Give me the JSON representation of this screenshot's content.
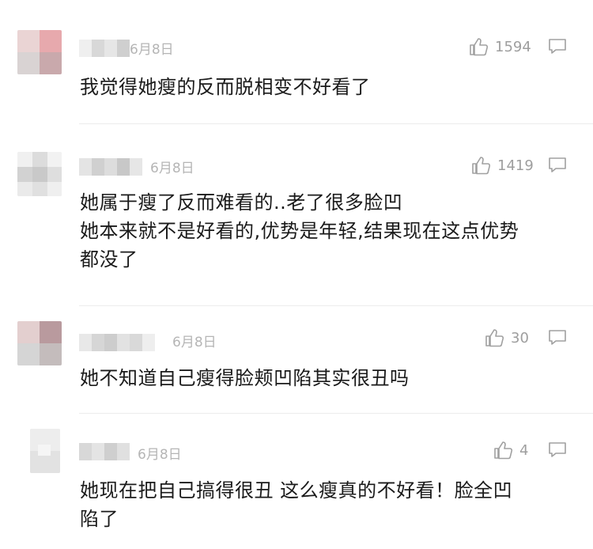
{
  "comments": [
    {
      "date": "6月8日",
      "likes": "1594",
      "lines": [
        "我觉得她瘦的反而脱相变不好看了"
      ]
    },
    {
      "date": "6月8日",
      "likes": "1419",
      "lines": [
        "她属于瘦了反而难看的..老了很多脸凹",
        "她本来就不是好看的,优势是年轻,结果现在这点优势",
        "都没了"
      ]
    },
    {
      "date": "6月8日",
      "likes": "30",
      "lines": [
        "她不知道自己瘦得脸颊凹陷其实很丑吗"
      ]
    },
    {
      "date": "6月8日",
      "likes": "4",
      "lines": [
        "她现在把自己搞得很丑 这么瘦真的不好看！脸全凹",
        "陷了"
      ]
    }
  ],
  "icons": {
    "like": "thumbs-up-icon",
    "reply": "comment-bubble-icon",
    "avatar": "blurred-avatar"
  },
  "colors": {
    "text": "#1a1a1a",
    "meta": "#b5b5b5",
    "icon": "#9e9e9e",
    "divider": "#ececec"
  }
}
